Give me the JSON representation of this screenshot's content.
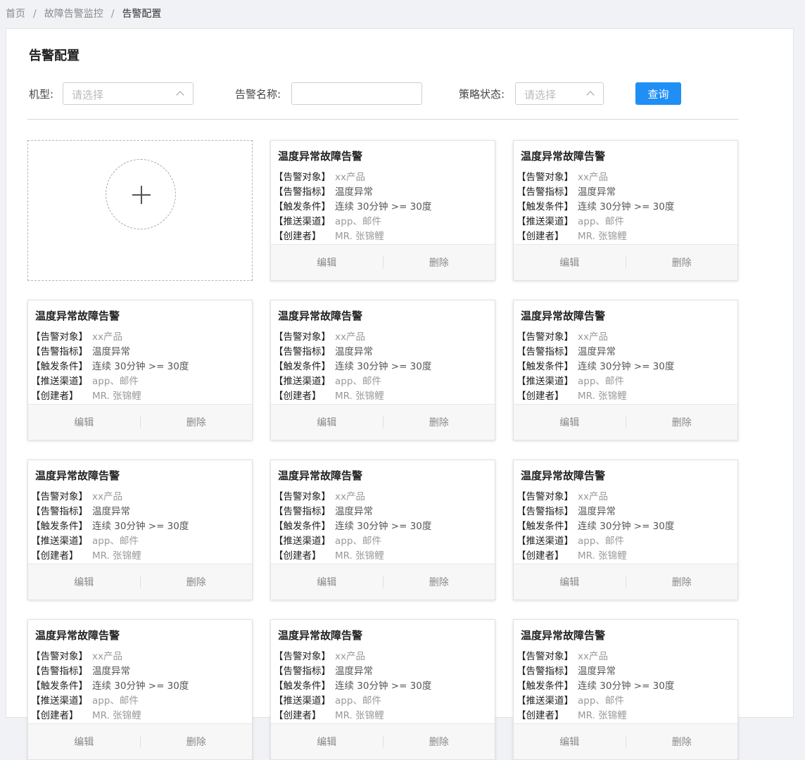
{
  "breadcrumb": {
    "items": [
      "首页",
      "故障告警监控"
    ],
    "separator": "/",
    "current": "告警配置"
  },
  "page": {
    "title": "告警配置"
  },
  "filters": {
    "model_label": "机型:",
    "model_placeholder": "请选择",
    "name_label": "告警名称:",
    "name_value": "",
    "status_label": "策略状态:",
    "status_placeholder": "请选择",
    "query_button": "查询"
  },
  "cards": [
    {
      "title": "温度异常故障告警",
      "target_label": "【告警对象】",
      "target": "xx产品",
      "metric_label": "【告警指标】",
      "metric": "温度异常",
      "condition_label": "【触发条件】",
      "condition": "连续 30分钟 >= 30度",
      "channel_label": "【推送渠道】",
      "channel": "app、邮件",
      "creator_label": "【创建者】",
      "creator": "MR. 张锦鲤",
      "edit": "编辑",
      "delete": "删除"
    },
    {
      "title": "温度异常故障告警",
      "target_label": "【告警对象】",
      "target": "xx产品",
      "metric_label": "【告警指标】",
      "metric": "温度异常",
      "condition_label": "【触发条件】",
      "condition": "连续 30分钟 >= 30度",
      "channel_label": "【推送渠道】",
      "channel": "app、邮件",
      "creator_label": "【创建者】",
      "creator": "MR. 张锦鲤",
      "edit": "编辑",
      "delete": "删除"
    },
    {
      "title": "温度异常故障告警",
      "target_label": "【告警对象】",
      "target": "xx产品",
      "metric_label": "【告警指标】",
      "metric": "温度异常",
      "condition_label": "【触发条件】",
      "condition": "连续 30分钟 >= 30度",
      "channel_label": "【推送渠道】",
      "channel": "app、邮件",
      "creator_label": "【创建者】",
      "creator": "MR. 张锦鲤",
      "edit": "编辑",
      "delete": "删除"
    },
    {
      "title": "温度异常故障告警",
      "target_label": "【告警对象】",
      "target": "xx产品",
      "metric_label": "【告警指标】",
      "metric": "温度异常",
      "condition_label": "【触发条件】",
      "condition": "连续 30分钟 >= 30度",
      "channel_label": "【推送渠道】",
      "channel": "app、邮件",
      "creator_label": "【创建者】",
      "creator": "MR. 张锦鲤",
      "edit": "编辑",
      "delete": "删除"
    },
    {
      "title": "温度异常故障告警",
      "target_label": "【告警对象】",
      "target": "xx产品",
      "metric_label": "【告警指标】",
      "metric": "温度异常",
      "condition_label": "【触发条件】",
      "condition": "连续 30分钟 >= 30度",
      "channel_label": "【推送渠道】",
      "channel": "app、邮件",
      "creator_label": "【创建者】",
      "creator": "MR. 张锦鲤",
      "edit": "编辑",
      "delete": "删除"
    },
    {
      "title": "温度异常故障告警",
      "target_label": "【告警对象】",
      "target": "xx产品",
      "metric_label": "【告警指标】",
      "metric": "温度异常",
      "condition_label": "【触发条件】",
      "condition": "连续 30分钟 >= 30度",
      "channel_label": "【推送渠道】",
      "channel": "app、邮件",
      "creator_label": "【创建者】",
      "creator": "MR. 张锦鲤",
      "edit": "编辑",
      "delete": "删除"
    },
    {
      "title": "温度异常故障告警",
      "target_label": "【告警对象】",
      "target": "xx产品",
      "metric_label": "【告警指标】",
      "metric": "温度异常",
      "condition_label": "【触发条件】",
      "condition": "连续 30分钟 >= 30度",
      "channel_label": "【推送渠道】",
      "channel": "app、邮件",
      "creator_label": "【创建者】",
      "creator": "MR. 张锦鲤",
      "edit": "编辑",
      "delete": "删除"
    },
    {
      "title": "温度异常故障告警",
      "target_label": "【告警对象】",
      "target": "xx产品",
      "metric_label": "【告警指标】",
      "metric": "温度异常",
      "condition_label": "【触发条件】",
      "condition": "连续 30分钟 >= 30度",
      "channel_label": "【推送渠道】",
      "channel": "app、邮件",
      "creator_label": "【创建者】",
      "creator": "MR. 张锦鲤",
      "edit": "编辑",
      "delete": "删除"
    },
    {
      "title": "温度异常故障告警",
      "target_label": "【告警对象】",
      "target": "xx产品",
      "metric_label": "【告警指标】",
      "metric": "温度异常",
      "condition_label": "【触发条件】",
      "condition": "连续 30分钟 >= 30度",
      "channel_label": "【推送渠道】",
      "channel": "app、邮件",
      "creator_label": "【创建者】",
      "creator": "MR. 张锦鲤",
      "edit": "编辑",
      "delete": "删除"
    },
    {
      "title": "温度异常故障告警",
      "target_label": "【告警对象】",
      "target": "xx产品",
      "metric_label": "【告警指标】",
      "metric": "温度异常",
      "condition_label": "【触发条件】",
      "condition": "连续 30分钟 >= 30度",
      "channel_label": "【推送渠道】",
      "channel": "app、邮件",
      "creator_label": "【创建者】",
      "creator": "MR. 张锦鲤",
      "edit": "编辑",
      "delete": "删除"
    },
    {
      "title": "温度异常故障告警",
      "target_label": "【告警对象】",
      "target": "xx产品",
      "metric_label": "【告警指标】",
      "metric": "温度异常",
      "condition_label": "【触发条件】",
      "condition": "连续 30分钟 >= 30度",
      "channel_label": "【推送渠道】",
      "channel": "app、邮件",
      "creator_label": "【创建者】",
      "creator": "MR. 张锦鲤",
      "edit": "编辑",
      "delete": "删除"
    }
  ],
  "colors": {
    "accent": "#1f8ff5",
    "page_background": "#f0f2f5"
  },
  "icons": {
    "add": "plus-icon",
    "select": "chevron-up-icon"
  }
}
